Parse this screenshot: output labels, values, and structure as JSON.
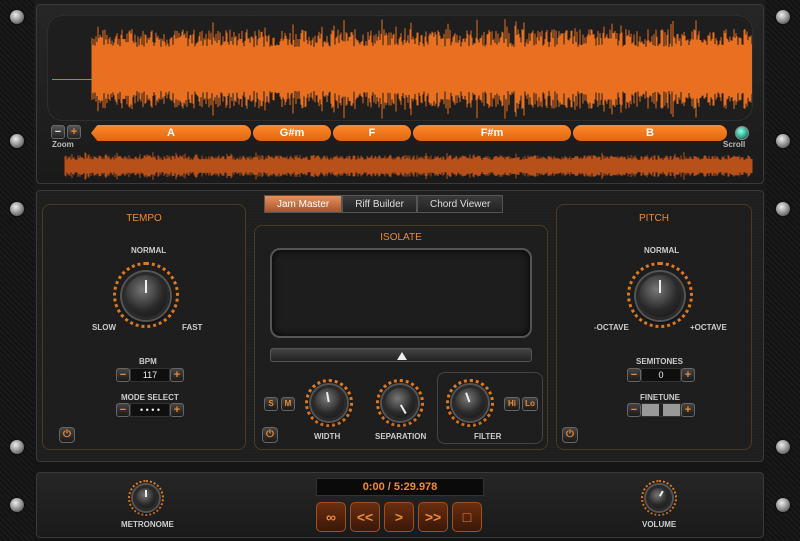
{
  "waveform": {
    "zoom_label": "Zoom",
    "scroll_label": "Scroll",
    "minus": "−",
    "plus": "+"
  },
  "chords": [
    "A",
    "G#m",
    "F",
    "F#m",
    "B"
  ],
  "tabs": [
    "Jam Master",
    "Riff Builder",
    "Chord Viewer"
  ],
  "tempo": {
    "title": "TEMPO",
    "normal": "NORMAL",
    "slow": "SLOW",
    "fast": "FAST",
    "bpm_label": "BPM",
    "bpm_value": "117",
    "mode_label": "MODE SELECT",
    "mode_value": "• • • •"
  },
  "isolate": {
    "title": "ISOLATE",
    "s": "S",
    "m": "M",
    "width": "WIDTH",
    "separation": "SEPARATION",
    "filter": "FILTER",
    "hi": "Hi",
    "lo": "Lo",
    "pan_value": 0.5
  },
  "pitch": {
    "title": "PITCH",
    "normal": "NORMAL",
    "minus_octave": "-OCTAVE",
    "plus_octave": "+OCTAVE",
    "semitones_label": "SEMITONES",
    "semitones_value": "0",
    "finetune_label": "FINETUNE"
  },
  "transport": {
    "time": "0:00 / 5:29.978",
    "loop": "∞",
    "rewind": "<<",
    "play": ">",
    "forward": ">>",
    "stop": "□"
  },
  "metronome_label": "METRONOME",
  "volume_label": "VOLUME",
  "power_symbol": "⏻",
  "colors": {
    "accent": "#f08a30",
    "waveform": "#e87020",
    "chord": "#ff7a1a"
  }
}
